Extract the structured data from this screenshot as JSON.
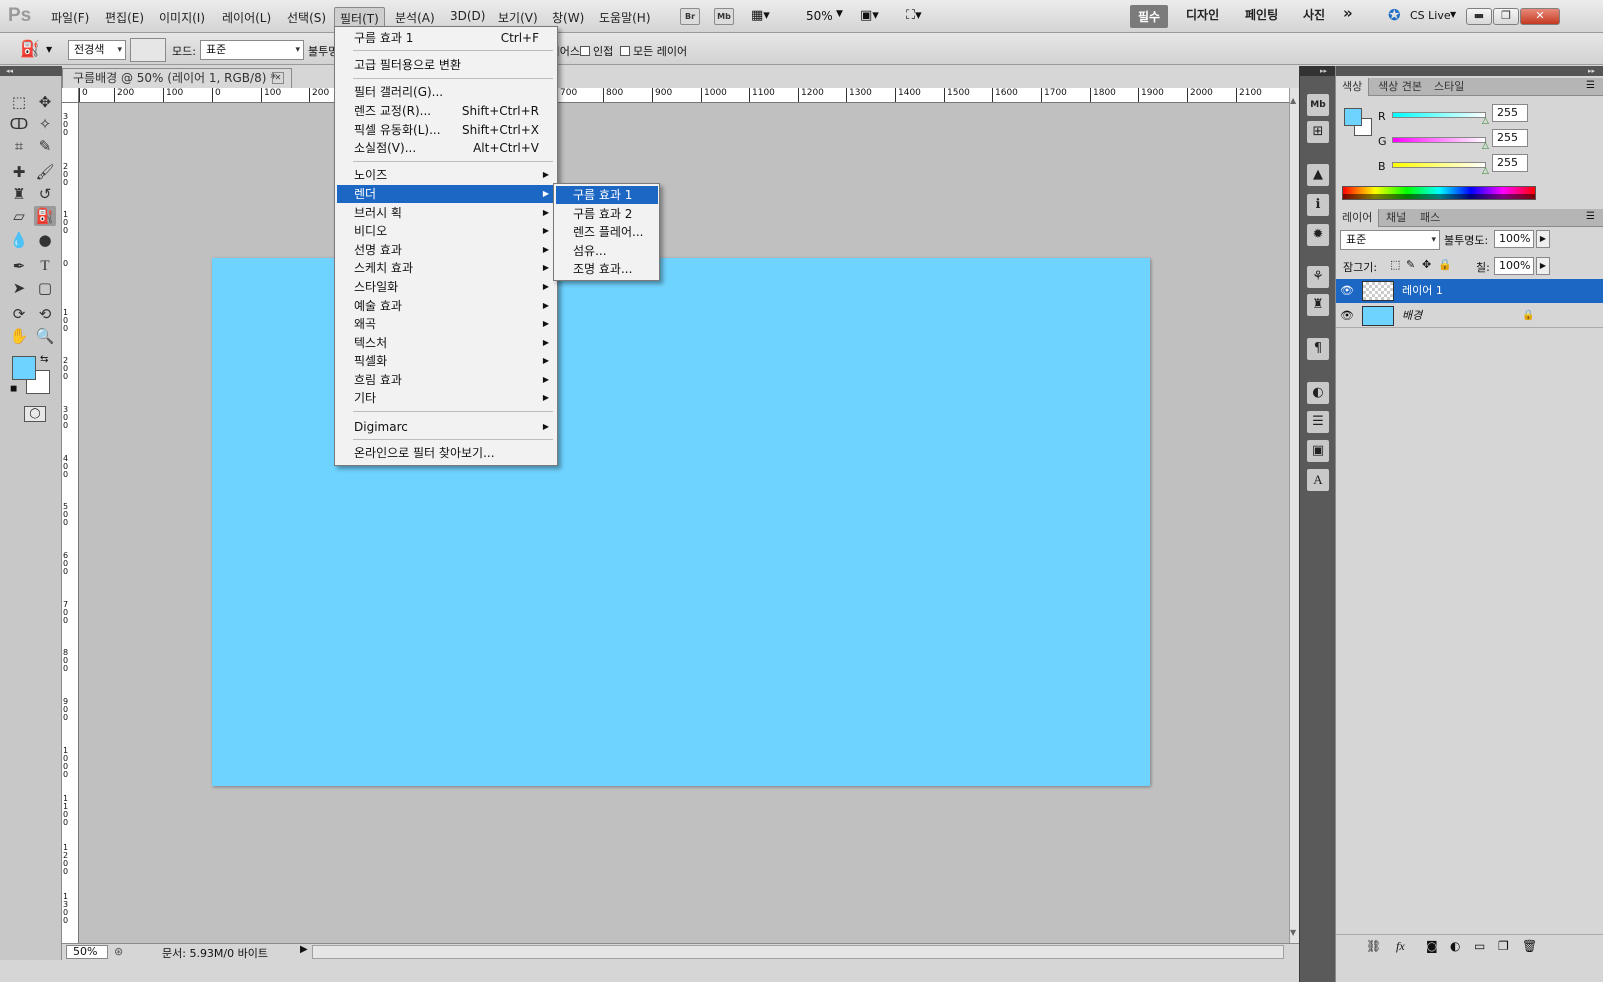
{
  "app": {
    "logo": "Ps"
  },
  "menubar": {
    "items": [
      "파일(F)",
      "편집(E)",
      "이미지(I)",
      "레이어(L)",
      "선택(S)",
      "필터(T)",
      "분석(A)",
      "3D(D)",
      "보기(V)",
      "창(W)",
      "도움말(H)"
    ],
    "bridge": "Br",
    "minibridge": "Mb",
    "zoom": "50%",
    "workspaces": [
      "필수",
      "디자인",
      "페인팅",
      "사진"
    ],
    "more": "»",
    "cslive": "CS Live"
  },
  "options": {
    "source": "전경색",
    "mode_label": "모드:",
    "mode_value": "표준",
    "opacity_label": "불투명",
    "antialias": "앤티 앨리어스",
    "contiguous": "인접",
    "all_layers": "모든 레이어"
  },
  "document": {
    "tab_title": "구름배경 @ 50% (레이어 1, RGB/8) *",
    "ruler_h": [
      "0",
      "200",
      "100",
      "0",
      "100",
      "200",
      "700",
      "800",
      "900",
      "1000",
      "1100",
      "1200",
      "1300",
      "1400",
      "1500",
      "1600",
      "1700",
      "1800",
      "1900",
      "2000",
      "2100"
    ],
    "ruler_v": [
      "3 0 0",
      "2 0 0",
      "1 0 0",
      "0",
      "1 0 0",
      "2 0 0",
      "3 0 0",
      "4 0 0",
      "5 0 0",
      "6 0 0",
      "7 0 0",
      "8 0 0",
      "9 0 0",
      "1 0 0 0",
      "1 1 0 0",
      "1 2 0 0",
      "1 3 0 0"
    ],
    "canvas_color": "#6fd3ff"
  },
  "status": {
    "zoom": "50%",
    "doc_info": "문서: 5.93M/0 바이트"
  },
  "filter_menu": {
    "items": [
      {
        "label": "구름 효과 1",
        "shortcut": "Ctrl+F"
      },
      {
        "label": "고급 필터용으로 변환",
        "shortcut": ""
      },
      {
        "label": "필터 갤러리(G)...",
        "shortcut": ""
      },
      {
        "label": "렌즈 교정(R)...",
        "shortcut": "Shift+Ctrl+R"
      },
      {
        "label": "픽셀 유동화(L)...",
        "shortcut": "Shift+Ctrl+X"
      },
      {
        "label": "소실점(V)...",
        "shortcut": "Alt+Ctrl+V"
      },
      {
        "label": "노이즈",
        "shortcut": ""
      },
      {
        "label": "렌더",
        "shortcut": ""
      },
      {
        "label": "브러시 획",
        "shortcut": ""
      },
      {
        "label": "비디오",
        "shortcut": ""
      },
      {
        "label": "선명 효과",
        "shortcut": ""
      },
      {
        "label": "스케치 효과",
        "shortcut": ""
      },
      {
        "label": "스타일화",
        "shortcut": ""
      },
      {
        "label": "예술 효과",
        "shortcut": ""
      },
      {
        "label": "왜곡",
        "shortcut": ""
      },
      {
        "label": "텍스처",
        "shortcut": ""
      },
      {
        "label": "픽셀화",
        "shortcut": ""
      },
      {
        "label": "흐림 효과",
        "shortcut": ""
      },
      {
        "label": "기타",
        "shortcut": ""
      },
      {
        "label": "Digimarc",
        "shortcut": ""
      },
      {
        "label": "온라인으로 필터 찾아보기...",
        "shortcut": ""
      }
    ],
    "render_submenu": [
      "구름 효과 1",
      "구름 효과 2",
      "렌즈 플레어...",
      "섬유...",
      "조명 효과..."
    ]
  },
  "color_panel": {
    "tabs": [
      "색상",
      "색상 견본",
      "스타일"
    ],
    "r_label": "R",
    "g_label": "G",
    "b_label": "B",
    "r": "255",
    "g": "255",
    "b": "255"
  },
  "layers_panel": {
    "tabs": [
      "레이어",
      "채널",
      "패스"
    ],
    "blend": "표준",
    "opacity_label": "불투명도:",
    "opacity": "100%",
    "lock_label": "잠그기:",
    "fill_label": "칠:",
    "fill": "100%",
    "layers": [
      {
        "name": "레이어 1",
        "selected": true
      },
      {
        "name": "배경",
        "selected": false
      }
    ]
  }
}
